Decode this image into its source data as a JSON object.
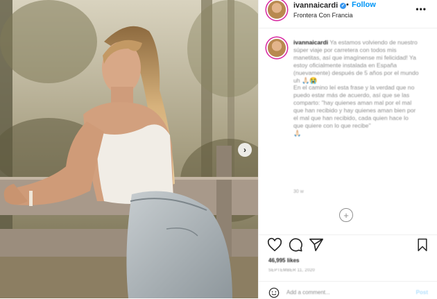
{
  "post": {
    "username": "ivannaicardi",
    "follow_label": "Follow",
    "dot": "•",
    "location": "Frontera Con Francia",
    "more": "•••"
  },
  "caption": {
    "username": "ivannaicardi",
    "paragraph1": "Ya estamos volviendo de nuestro súper viaje por carretera con todos mis manetitas, así que imagínense mi felicidad! Ya estoy oficialmente instalada en España (nuevamente) después de 5 años por el mundo uh",
    "paragraph2": "En el camino leí esta frase y la verdad que no puedo estar más de acuerdo, así que se las comparto: \"hay quienes aman mal por el mal que han recibido y hay quienes aman bien por el mal que han recibido, cada quien hace lo que quiere con lo que recibe\"",
    "time": "30 w"
  },
  "actions": {
    "likes": "46,995 likes",
    "date": "SEPTEMBER 11, 2020"
  },
  "comment_bar": {
    "placeholder": "Add a comment...",
    "post_label": "Post"
  },
  "icons": {
    "next": "chevron-right-icon",
    "verified": "verified-badge-icon",
    "like": "heart-icon",
    "comment": "comment-icon",
    "share": "share-icon",
    "save": "bookmark-icon",
    "emoji": "emoji-icon",
    "load_more": "plus-circle-icon"
  },
  "colors": {
    "follow": "#0095f6",
    "verified": "#3897f0",
    "post_disabled": "#b2dffc"
  }
}
